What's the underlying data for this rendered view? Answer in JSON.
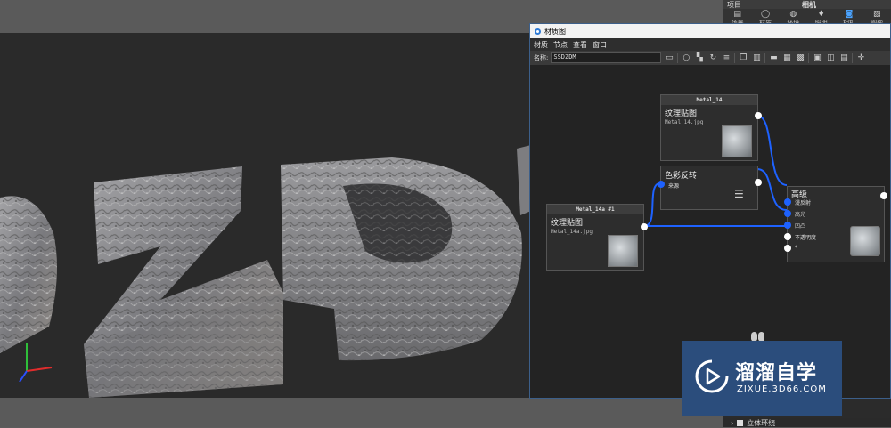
{
  "right_panel": {
    "header_left": "项目",
    "header_center": "相机",
    "tabs": [
      {
        "label": "场景",
        "icon": "scene-icon"
      },
      {
        "label": "材质",
        "icon": "material-icon"
      },
      {
        "label": "环境",
        "icon": "environment-icon"
      },
      {
        "label": "照明",
        "icon": "light-icon"
      },
      {
        "label": "相机",
        "icon": "camera-icon"
      },
      {
        "label": "图像",
        "icon": "image-icon"
      }
    ],
    "active_tab": "相机",
    "bottom_checkbox_label": "立体环绕"
  },
  "material_window": {
    "title": "材质图",
    "menu": [
      "材质",
      "节点",
      "查看",
      "窗口"
    ],
    "name_label": "名称:",
    "name_value": "SSDZDM",
    "nodes": {
      "metal14": {
        "header": "Metal_14",
        "title": "纹理贴图",
        "file": "Metal_14.jpg"
      },
      "invert": {
        "title": "色彩反转",
        "input_label": "来源"
      },
      "metal14a": {
        "header": "Metal_14a #1",
        "title": "纹理贴图",
        "file": "Metal_14a.jpg"
      },
      "advanced": {
        "title": "高级",
        "inputs": [
          "漫反射",
          "高光",
          "凹凸",
          "不透明度",
          "*"
        ]
      }
    }
  },
  "watermark": {
    "title": "溜溜自学",
    "url": "ZIXUE.3D66.COM"
  },
  "colors": {
    "accent": "#1e62ff",
    "watermark_bg": "#2b4d7c",
    "window_border": "#3c5f8a"
  }
}
